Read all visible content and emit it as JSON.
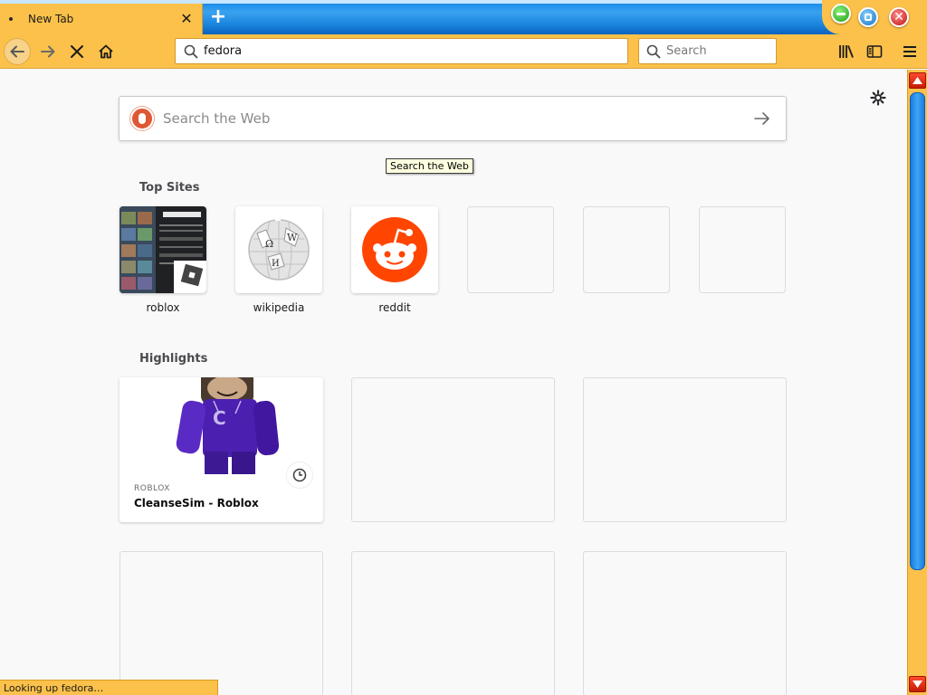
{
  "tabs": [
    {
      "title": "New Tab"
    }
  ],
  "toolbar": {
    "url_value": "fedora",
    "search_placeholder": "Search"
  },
  "newtab": {
    "search_placeholder": "Search the Web",
    "tooltip": "Search the Web",
    "top_sites_title": "Top Sites",
    "top_sites": [
      {
        "label": "roblox"
      },
      {
        "label": "wikipedia"
      },
      {
        "label": "reddit"
      },
      {
        "label": ""
      },
      {
        "label": ""
      },
      {
        "label": ""
      }
    ],
    "highlights_title": "Highlights",
    "highlights": [
      {
        "source": "ROBLOX",
        "title": "CleanseSim - Roblox"
      }
    ]
  },
  "status": {
    "text": "Looking up fedora…"
  },
  "colors": {
    "toolbar": "#fbc14a",
    "titlebar_blue": "#1a86de",
    "reddit": "#ff4500",
    "ddg": "#de5833"
  }
}
